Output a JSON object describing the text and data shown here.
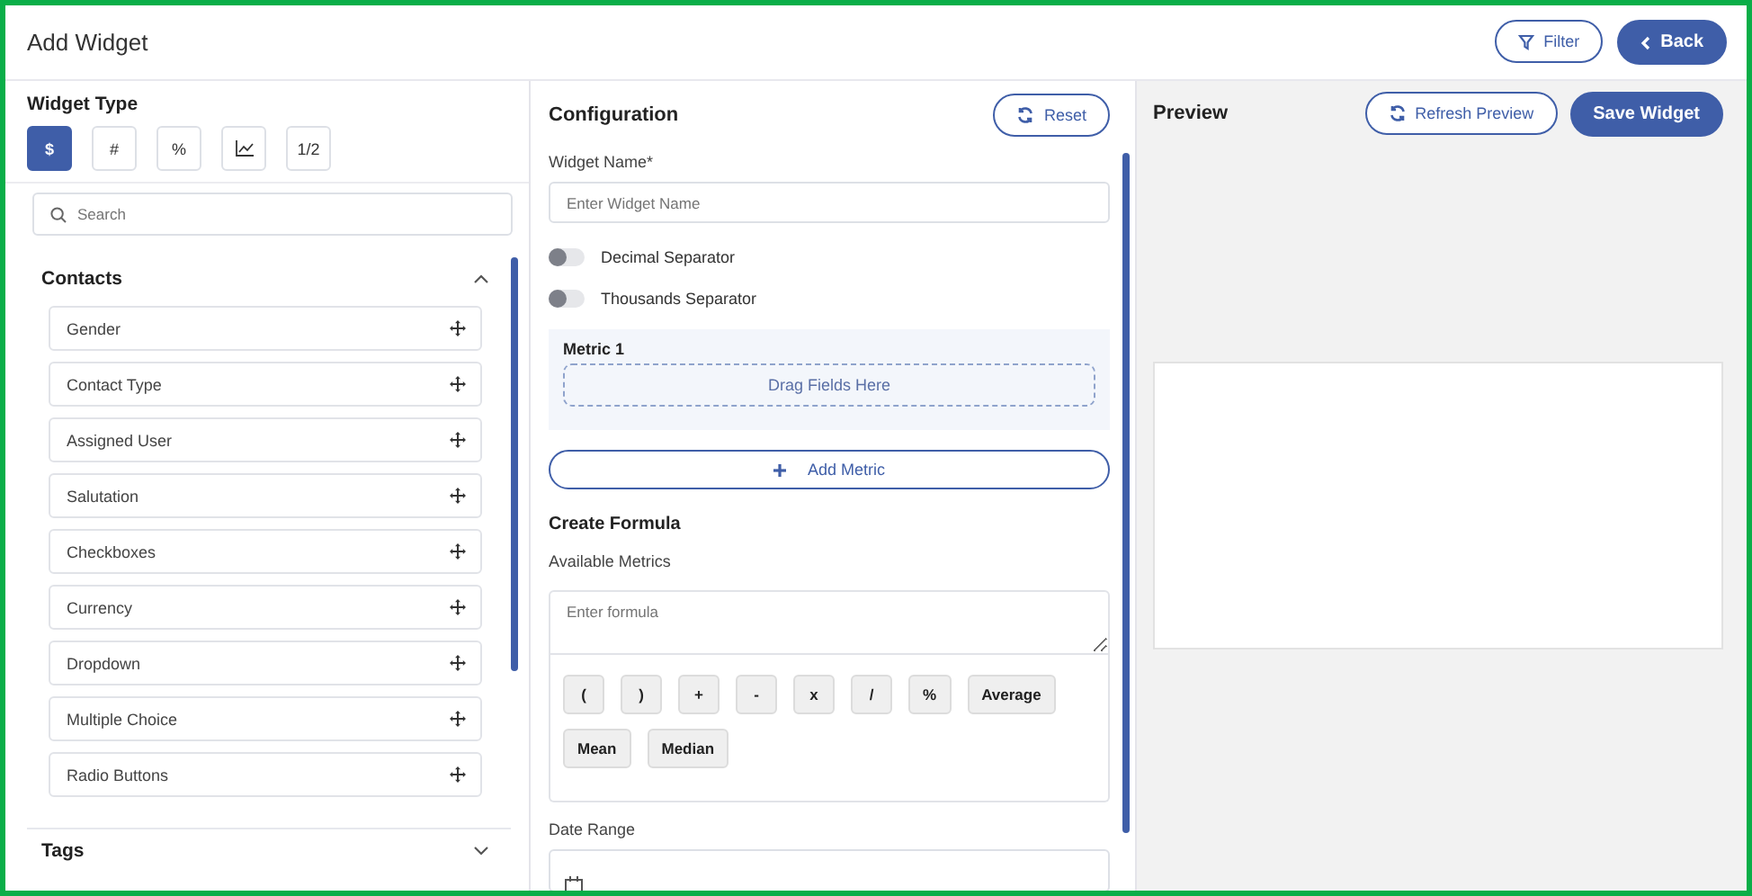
{
  "header": {
    "title": "Add Widget",
    "buttons": [
      {
        "label": "Filter",
        "kind": "outline"
      },
      {
        "label": "Back",
        "kind": "primary"
      }
    ]
  },
  "widget_type": {
    "title": "Widget Type",
    "options": [
      {
        "kind": "text",
        "label": "$",
        "selected": true
      },
      {
        "kind": "text",
        "label": "#",
        "selected": false
      },
      {
        "kind": "text",
        "label": "%",
        "selected": false
      },
      {
        "kind": "chart",
        "selected": false
      },
      {
        "kind": "text",
        "label": "1/2",
        "selected": false
      }
    ]
  },
  "search": {
    "placeholder": "Search"
  },
  "groups": [
    {
      "title": "Contacts",
      "expanded": true,
      "fields": [
        "Gender",
        "Contact Type",
        "Assigned User",
        "Salutation",
        "Checkboxes",
        "Currency",
        "Dropdown",
        "Multiple Choice",
        "Radio Buttons"
      ]
    },
    {
      "title": "Tags",
      "expanded": false
    }
  ],
  "configuration": {
    "title": "Configuration",
    "reset": "Reset",
    "name_label": "Widget Name*",
    "name_placeholder": "Enter Widget Name",
    "toggles": [
      {
        "label": "Decimal Separator",
        "on": false
      },
      {
        "label": "Thousands Separator",
        "on": false
      }
    ],
    "metric": {
      "title": "Metric 1",
      "drop_hint": "Drag Fields Here"
    },
    "add_metric": "Add Metric",
    "formula_title": "Create Formula",
    "metrics_label": "Available Metrics",
    "formula_placeholder": "Enter formula",
    "operators": [
      "(",
      ")",
      "+",
      "-",
      "x",
      "/",
      "%",
      "Average",
      "Mean",
      "Median"
    ],
    "date_label": "Date Range"
  },
  "preview": {
    "title": "Preview",
    "buttons": [
      {
        "label": "Refresh Preview",
        "kind": "outline"
      },
      {
        "label": "Save Widget",
        "kind": "primary"
      }
    ]
  }
}
